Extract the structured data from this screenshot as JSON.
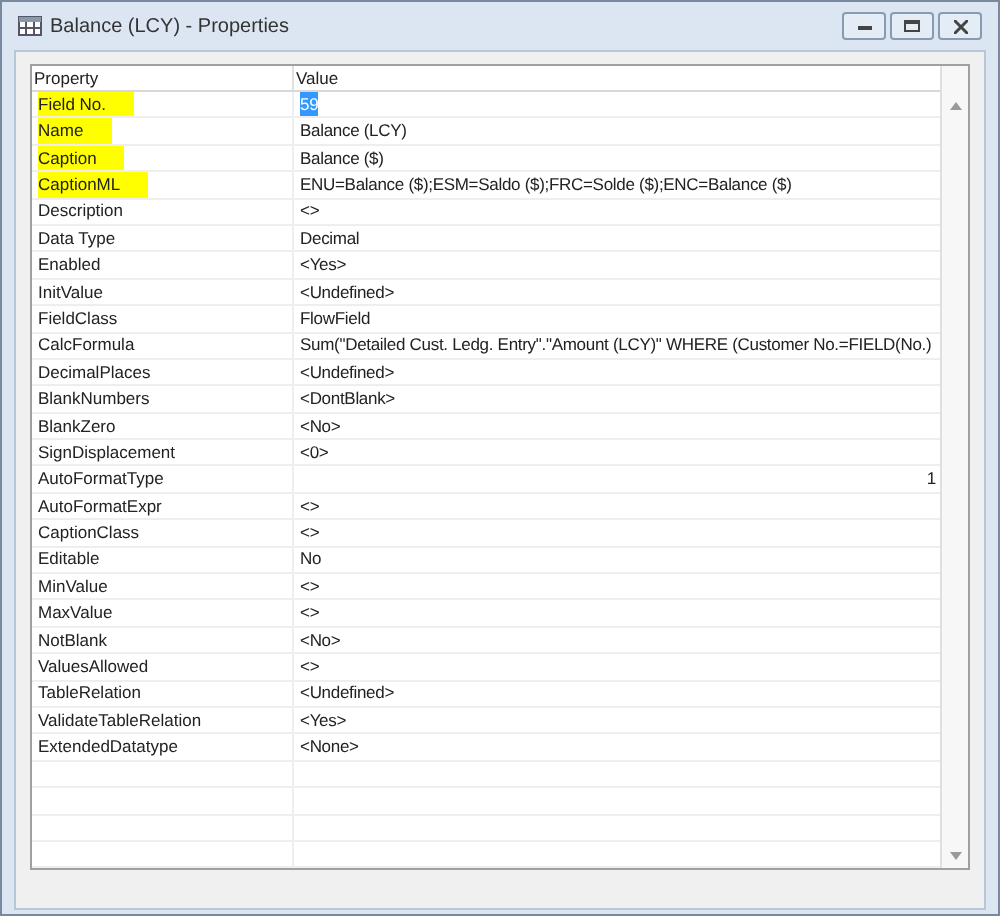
{
  "window": {
    "title": "Balance (LCY) - Properties"
  },
  "table": {
    "columns": [
      "Property",
      "Value"
    ],
    "rows": [
      {
        "property": "Field No.",
        "value": "59",
        "kind": "text",
        "highlighted": true,
        "selected": true
      },
      {
        "property": "Name",
        "value": "Balance (LCY)",
        "kind": "text",
        "highlighted": true,
        "selected": false
      },
      {
        "property": "Caption",
        "value": "Balance ($)",
        "kind": "text",
        "highlighted": true,
        "selected": false
      },
      {
        "property": "CaptionML",
        "value": "ENU=Balance ($);ESM=Saldo ($);FRC=Solde ($);ENC=Balance ($)",
        "kind": "text",
        "highlighted": true,
        "selected": false
      },
      {
        "property": "Description",
        "value": "<>",
        "kind": "text",
        "highlighted": false,
        "selected": false
      },
      {
        "property": "Data Type",
        "value": "Decimal",
        "kind": "text",
        "highlighted": false,
        "selected": false
      },
      {
        "property": "Enabled",
        "value": "<Yes>",
        "kind": "text",
        "highlighted": false,
        "selected": false
      },
      {
        "property": "InitValue",
        "value": "<Undefined>",
        "kind": "text",
        "highlighted": false,
        "selected": false
      },
      {
        "property": "FieldClass",
        "value": "FlowField",
        "kind": "text",
        "highlighted": false,
        "selected": false
      },
      {
        "property": "CalcFormula",
        "value": "Sum(\"Detailed Cust. Ledg. Entry\".\"Amount (LCY)\" WHERE (Customer No.=FIELD(No.)",
        "kind": "text",
        "highlighted": false,
        "selected": false
      },
      {
        "property": "DecimalPlaces",
        "value": "<Undefined>",
        "kind": "text",
        "highlighted": false,
        "selected": false
      },
      {
        "property": "BlankNumbers",
        "value": "<DontBlank>",
        "kind": "text",
        "highlighted": false,
        "selected": false
      },
      {
        "property": "BlankZero",
        "value": "<No>",
        "kind": "text",
        "highlighted": false,
        "selected": false
      },
      {
        "property": "SignDisplacement",
        "value": "<0>",
        "kind": "text",
        "highlighted": false,
        "selected": false
      },
      {
        "property": "AutoFormatType",
        "value": "1",
        "kind": "number",
        "highlighted": false,
        "selected": false
      },
      {
        "property": "AutoFormatExpr",
        "value": "<>",
        "kind": "text",
        "highlighted": false,
        "selected": false
      },
      {
        "property": "CaptionClass",
        "value": "<>",
        "kind": "text",
        "highlighted": false,
        "selected": false
      },
      {
        "property": "Editable",
        "value": "No",
        "kind": "text",
        "highlighted": false,
        "selected": false
      },
      {
        "property": "MinValue",
        "value": "<>",
        "kind": "text",
        "highlighted": false,
        "selected": false
      },
      {
        "property": "MaxValue",
        "value": "<>",
        "kind": "text",
        "highlighted": false,
        "selected": false
      },
      {
        "property": "NotBlank",
        "value": "<No>",
        "kind": "text",
        "highlighted": false,
        "selected": false
      },
      {
        "property": "ValuesAllowed",
        "value": "<>",
        "kind": "text",
        "highlighted": false,
        "selected": false
      },
      {
        "property": "TableRelation",
        "value": "<Undefined>",
        "kind": "text",
        "highlighted": false,
        "selected": false
      },
      {
        "property": "ValidateTableRelation",
        "value": "<Yes>",
        "kind": "text",
        "highlighted": false,
        "selected": false
      },
      {
        "property": "ExtendedDatatype",
        "value": "<None>",
        "kind": "text",
        "highlighted": false,
        "selected": false
      }
    ]
  }
}
